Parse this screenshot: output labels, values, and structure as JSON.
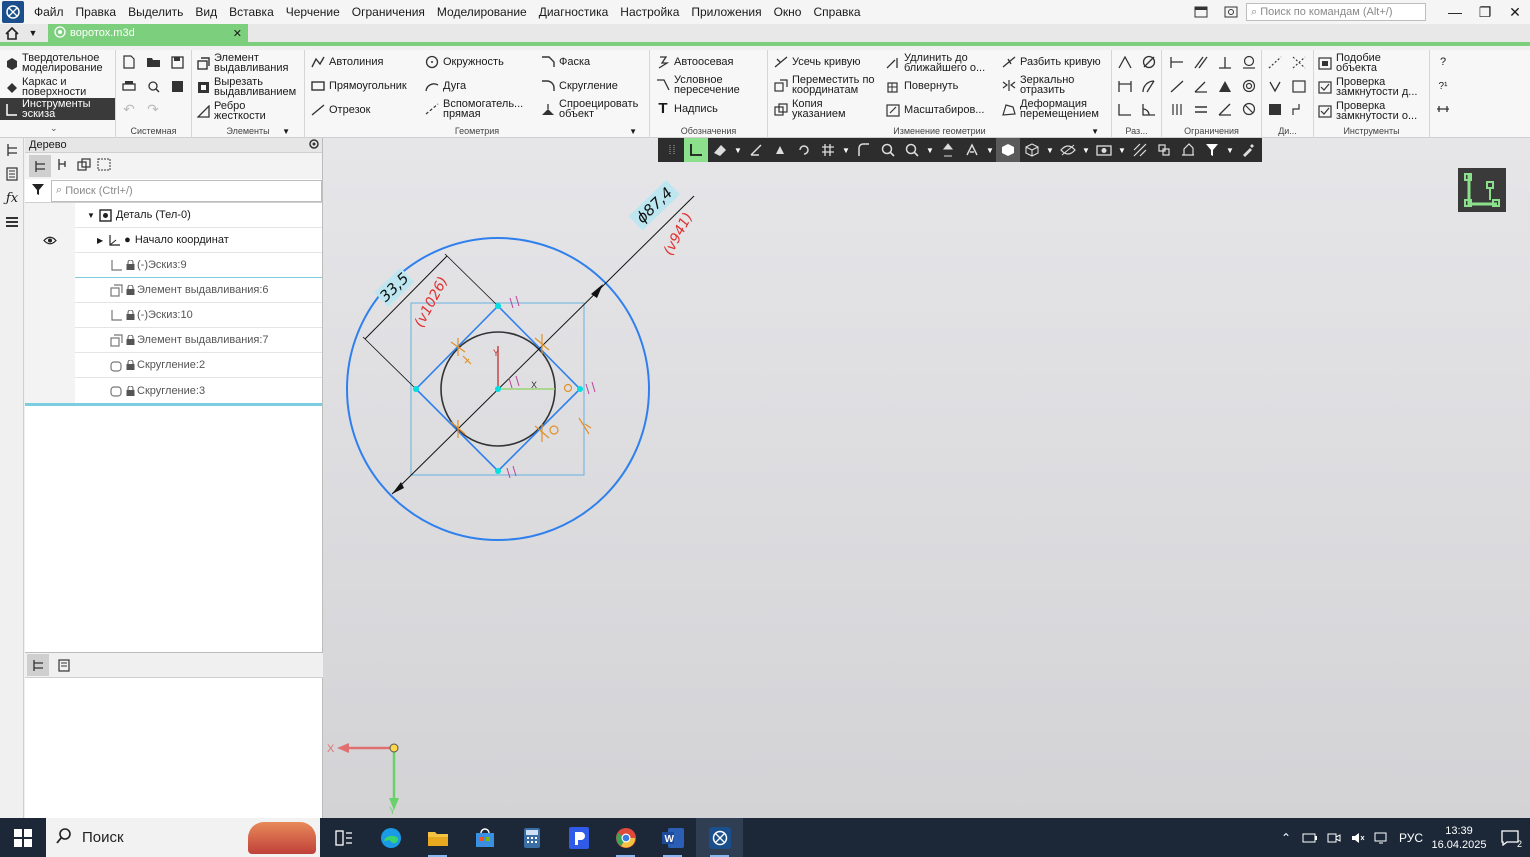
{
  "menu": {
    "items": [
      "Файл",
      "Правка",
      "Выделить",
      "Вид",
      "Вставка",
      "Черчение",
      "Ограничения",
      "Моделирование",
      "Диагностика",
      "Настройка",
      "Приложения",
      "Окно",
      "Справка"
    ],
    "command_search_placeholder": "Поиск по командам (Alt+/)"
  },
  "tabs": {
    "document": "воротох.m3d"
  },
  "ribbon": {
    "modes": {
      "solid": "Твердотельное моделирование",
      "wire": "Каркас и поверхности",
      "sketch_tools": "Инструменты эскиза"
    },
    "groups": {
      "system": "Системная",
      "elements": "Элементы",
      "geometry": "Геометрия",
      "annotations": "Обозначения",
      "geometry_edit": "Изменение геометрии",
      "sizes": "Раз...",
      "constraints": "Ограничения",
      "di": "Ди...",
      "tools": "Инструменты"
    },
    "elements": {
      "extrude": "Элемент выдавливания",
      "cut": "Вырезать выдавливанием",
      "rib": "Ребро жесткости"
    },
    "geometry": {
      "autoline": "Автолиния",
      "rect": "Прямоугольник",
      "segment": "Отрезок",
      "circle": "Окружность",
      "arc": "Дуга",
      "aux_line": "Вспомогатель... прямая",
      "chamfer": "Фаска",
      "fillet": "Скругление",
      "project": "Спроецировать объект"
    },
    "annotations": {
      "axis": "Автоосевая",
      "cond_cross": "Условное пересечение",
      "label": "Надпись"
    },
    "geometry_edit": {
      "trim": "Усечь кривую",
      "move_coords": "Переместить по координатам",
      "copy": "Копия указанием",
      "extend": "Удлинить до ближайшего о...",
      "rotate": "Повернуть",
      "scale": "Масштабиров...",
      "split": "Разбить кривую",
      "mirror": "Зеркально отразить",
      "deform": "Деформация перемещением"
    },
    "tools": {
      "similar": "Подобие объекта",
      "check1": "Проверка замкнутости д...",
      "check2": "Проверка замкнутости о..."
    }
  },
  "tree": {
    "title": "Дерево",
    "search_placeholder": "Поиск (Ctrl+/)",
    "rows": [
      {
        "label": "Деталь (Тел-0)",
        "indent": 0
      },
      {
        "label": "Начало координат",
        "indent": 1
      },
      {
        "label": "(-)Эскиз:9",
        "indent": 2
      },
      {
        "label": "Элемент выдавливания:6",
        "indent": 2
      },
      {
        "label": "(-)Эскиз:10",
        "indent": 2
      },
      {
        "label": "Элемент выдавливания:7",
        "indent": 2
      },
      {
        "label": "Скругление:2",
        "indent": 2
      },
      {
        "label": "Скругление:3",
        "indent": 2
      }
    ]
  },
  "sketch": {
    "dim_diameter": "ϕ87,4",
    "dim_diameter_var": "(v941)",
    "dim_length": "33,5",
    "dim_length_var": "(v1026)",
    "axis_x": "X",
    "axis_y": "Y"
  },
  "taskbar": {
    "search": "Поиск",
    "lang": "РУС",
    "time": "13:39",
    "date": "16.04.2025",
    "notifications": "2"
  },
  "colors": {
    "accent_green": "#7ccf7d",
    "sketch_blue": "#2f80ed",
    "constraint_orange": "#e0902a",
    "dimension_red": "#e03030",
    "taskbar": "#1c2838"
  }
}
